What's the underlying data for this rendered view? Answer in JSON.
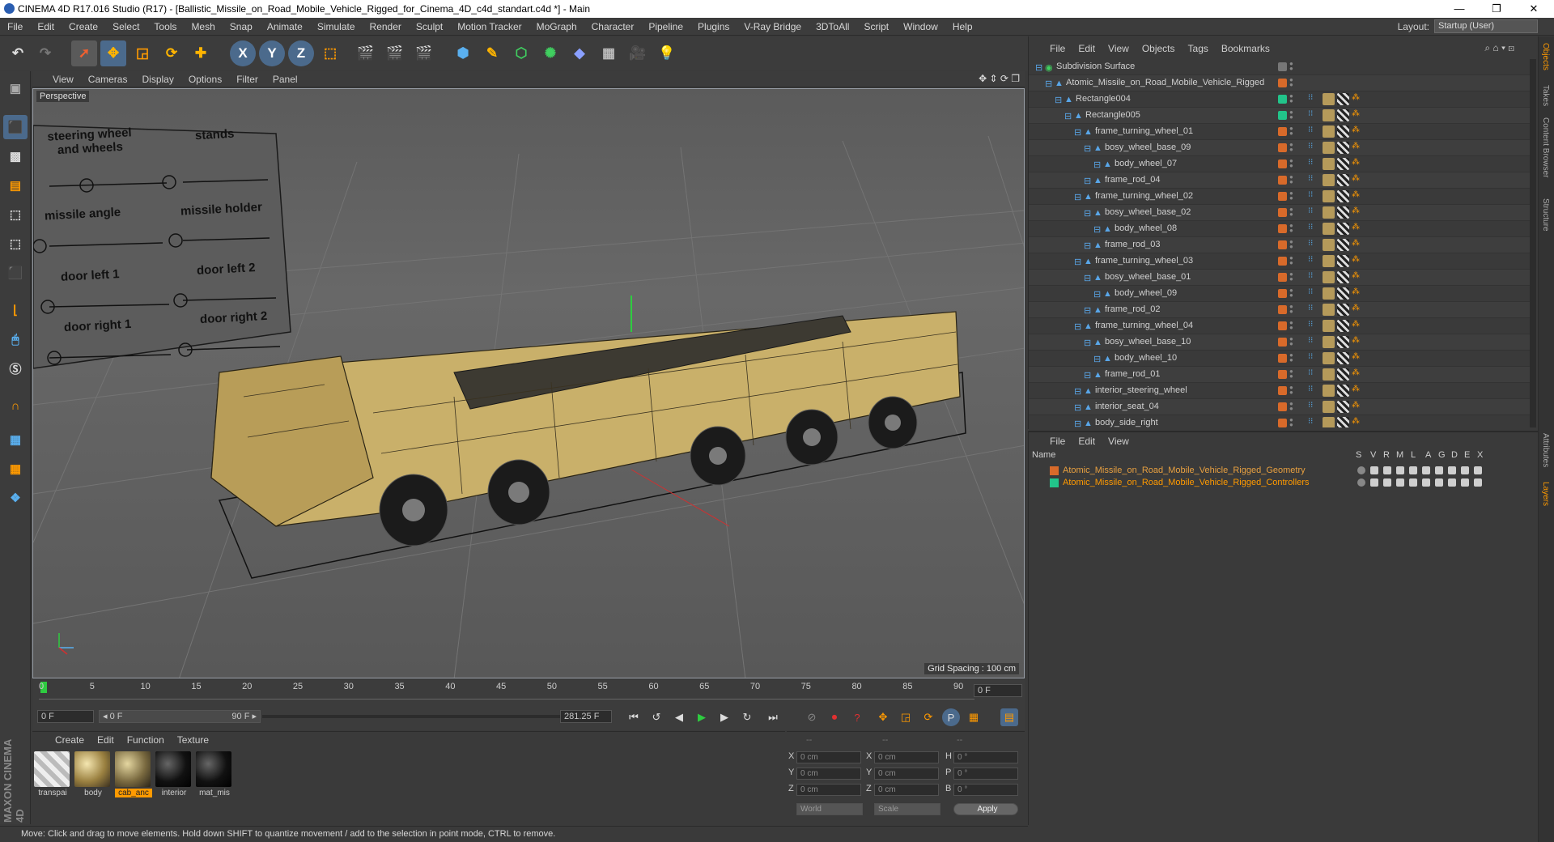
{
  "window": {
    "title": "CINEMA 4D R17.016 Studio (R17) - [Ballistic_Missile_on_Road_Mobile_Vehicle_Rigged_for_Cinema_4D_c4d_standart.c4d *] - Main",
    "controls": [
      "—",
      "❐",
      "✕"
    ]
  },
  "menubar": {
    "items": [
      "File",
      "Edit",
      "Create",
      "Select",
      "Tools",
      "Mesh",
      "Snap",
      "Animate",
      "Simulate",
      "Render",
      "Sculpt",
      "Motion Tracker",
      "MoGraph",
      "Character",
      "Pipeline",
      "Plugins",
      "V-Ray Bridge",
      "3DToAll",
      "Script",
      "Window",
      "Help"
    ],
    "layout_label": "Layout:",
    "layout_value": "Startup (User)"
  },
  "toolbar": {
    "axis_x": "X",
    "axis_y": "Y",
    "axis_z": "Z"
  },
  "viewport": {
    "menu": [
      "View",
      "Cameras",
      "Display",
      "Options",
      "Filter",
      "Panel"
    ],
    "label": "Perspective",
    "grid_spacing": "Grid Spacing : 100 cm",
    "control_labels": [
      "steering wheel\nand wheels",
      "stands",
      "missile angle",
      "missile holder",
      "door left 1",
      "door left 2",
      "door right 1",
      "door right 2"
    ]
  },
  "timeline": {
    "ticks": [
      "0",
      "5",
      "10",
      "15",
      "20",
      "25",
      "30",
      "35",
      "40",
      "45",
      "50",
      "55",
      "60",
      "65",
      "70",
      "75",
      "80",
      "85",
      "90"
    ],
    "current_frame_field": "0 F",
    "start_field": "0 F",
    "range_start": "◂ 0 F",
    "range_end": "90 F ▸",
    "fps_field": "281.25 F"
  },
  "materials": {
    "menu": [
      "Create",
      "Edit",
      "Function",
      "Texture"
    ],
    "items": [
      {
        "name": "transpai",
        "color": "#d0d0d0"
      },
      {
        "name": "body",
        "color": "#b59a5a"
      },
      {
        "name": "cab_anc",
        "color": "#8a7a50",
        "selected": true
      },
      {
        "name": "interior",
        "color": "#1b1b1b"
      },
      {
        "name": "mat_mis",
        "color": "#1e1e1e"
      }
    ]
  },
  "coords": {
    "headers": [
      "--",
      "--",
      "--"
    ],
    "rows": [
      {
        "a": "X",
        "av": "0 cm",
        "b": "X",
        "bv": "0 cm",
        "c": "H",
        "cv": "0 °"
      },
      {
        "a": "Y",
        "av": "0 cm",
        "b": "Y",
        "bv": "0 cm",
        "c": "P",
        "cv": "0 °"
      },
      {
        "a": "Z",
        "av": "0 cm",
        "b": "Z",
        "bv": "0 cm",
        "c": "B",
        "cv": "0 °"
      }
    ],
    "world": "World",
    "scale": "Scale",
    "apply": "Apply"
  },
  "status": "Move: Click and drag to move elements. Hold down SHIFT to quantize movement / add to the selection in point mode, CTRL to remove.",
  "objects": {
    "menu": [
      "File",
      "Edit",
      "View",
      "Objects",
      "Tags",
      "Bookmarks"
    ],
    "rows": [
      {
        "name": "Subdivision Surface",
        "indent": 0,
        "color": "#777777"
      },
      {
        "name": "Atomic_Missile_on_Road_Mobile_Vehicle_Rigged",
        "indent": 1,
        "color": "#d86a2a"
      },
      {
        "name": "Rectangle004",
        "indent": 2,
        "color": "#22c48a"
      },
      {
        "name": "Rectangle005",
        "indent": 3,
        "color": "#22c48a"
      },
      {
        "name": "frame_turning_wheel_01",
        "indent": 4,
        "color": "#d86a2a"
      },
      {
        "name": "bosy_wheel_base_09",
        "indent": 5,
        "color": "#d86a2a"
      },
      {
        "name": "body_wheel_07",
        "indent": 6,
        "color": "#d86a2a"
      },
      {
        "name": "frame_rod_04",
        "indent": 5,
        "color": "#d86a2a"
      },
      {
        "name": "frame_turning_wheel_02",
        "indent": 4,
        "color": "#d86a2a"
      },
      {
        "name": "bosy_wheel_base_02",
        "indent": 5,
        "color": "#d86a2a"
      },
      {
        "name": "body_wheel_08",
        "indent": 6,
        "color": "#d86a2a"
      },
      {
        "name": "frame_rod_03",
        "indent": 5,
        "color": "#d86a2a"
      },
      {
        "name": "frame_turning_wheel_03",
        "indent": 4,
        "color": "#d86a2a"
      },
      {
        "name": "bosy_wheel_base_01",
        "indent": 5,
        "color": "#d86a2a"
      },
      {
        "name": "body_wheel_09",
        "indent": 6,
        "color": "#d86a2a"
      },
      {
        "name": "frame_rod_02",
        "indent": 5,
        "color": "#d86a2a"
      },
      {
        "name": "frame_turning_wheel_04",
        "indent": 4,
        "color": "#d86a2a"
      },
      {
        "name": "bosy_wheel_base_10",
        "indent": 5,
        "color": "#d86a2a"
      },
      {
        "name": "body_wheel_10",
        "indent": 6,
        "color": "#d86a2a"
      },
      {
        "name": "frame_rod_01",
        "indent": 5,
        "color": "#d86a2a"
      },
      {
        "name": "interior_steering_wheel",
        "indent": 4,
        "color": "#d86a2a"
      },
      {
        "name": "interior_seat_04",
        "indent": 4,
        "color": "#d86a2a"
      },
      {
        "name": "body_side_right",
        "indent": 4,
        "color": "#d86a2a"
      }
    ]
  },
  "layers": {
    "menu": [
      "File",
      "Edit",
      "View"
    ],
    "columns": [
      "Name",
      "S",
      "V",
      "R",
      "M",
      "L",
      "A",
      "G",
      "D",
      "E",
      "X"
    ],
    "rows": [
      {
        "name": "Atomic_Missile_on_Road_Mobile_Vehicle_Rigged_Geometry",
        "color": "#d86a2a",
        "text_color": "#e8a040"
      },
      {
        "name": "Atomic_Missile_on_Road_Mobile_Vehicle_Rigged_Controllers",
        "color": "#22c48a",
        "text_color": "#ff9a00"
      }
    ]
  },
  "side_tabs": [
    "Objects",
    "Takes",
    "Content Browser",
    "Structure",
    "Attributes",
    "Layers"
  ],
  "brand": "MAXON CINEMA 4D"
}
